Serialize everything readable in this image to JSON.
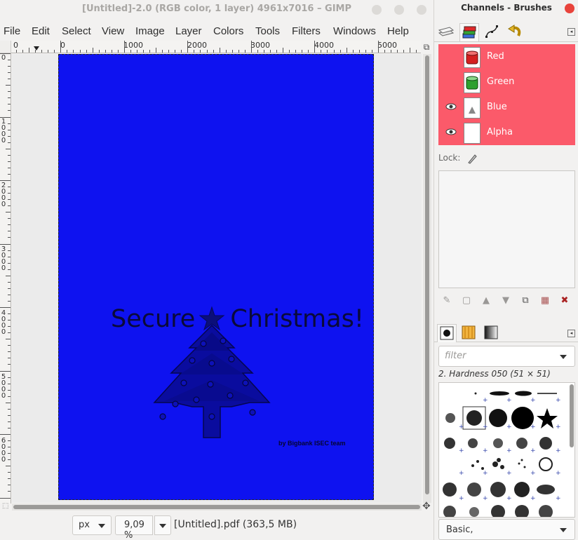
{
  "main_window": {
    "title": "[Untitled]-2.0 (RGB color, 1 layer) 4961x7016 – GIMP",
    "menu": [
      "File",
      "Edit",
      "Select",
      "View",
      "Image",
      "Layer",
      "Colors",
      "Tools",
      "Filters",
      "Windows",
      "Help"
    ]
  },
  "rulers": {
    "horizontal_labels": [
      "0",
      "0",
      "1000",
      "2000",
      "3000",
      "4000",
      "5000"
    ],
    "vertical_labels": [
      "0",
      "1\n0\n0\n0",
      "2\n0\n0\n0",
      "3\n0\n0\n0",
      "4\n0\n0\n0",
      "5\n0\n0\n0",
      "6\n0\n0\n0"
    ]
  },
  "document": {
    "background_color": "#0e12f0",
    "title_left": "Secure",
    "title_right": "Christmas!",
    "credit": "by Bigbank ISEC team"
  },
  "statusbar": {
    "unit": "px",
    "zoom": "9,09 %",
    "info": "[Untitled].pdf (363,5 MB)"
  },
  "dock": {
    "title": "Channels - Brushes",
    "channels": [
      {
        "name": "Red",
        "visible": false,
        "thumb_color": "#e02020"
      },
      {
        "name": "Green",
        "visible": false,
        "thumb_color": "#33a033"
      },
      {
        "name": "Blue",
        "visible": true,
        "thumb_color": "#ffffff"
      },
      {
        "name": "Alpha",
        "visible": true,
        "thumb_color": "#ffffff"
      }
    ],
    "channel_highlight_color": "#fb5a6a",
    "lock_label": "Lock:",
    "brush_filter_placeholder": "filter",
    "brush_name": "2. Hardness 050 (51 × 51)",
    "brush_preset": "Basic,"
  }
}
